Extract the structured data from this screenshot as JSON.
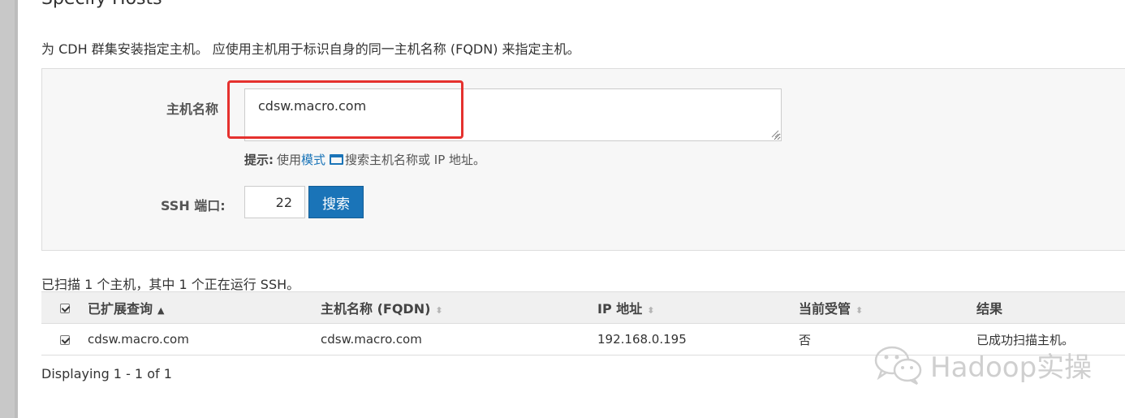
{
  "page": {
    "heading": "Specify Hosts",
    "intro": "为 CDH 群集安装指定主机。 应使用主机用于标识自身的同一主机名称 (FQDN) 来指定主机。"
  },
  "search": {
    "host_label": "主机名称",
    "host_value": "cdsw.macro.com",
    "hint_bold": "提示:",
    "hint_prefix": "使用",
    "hint_link": "模式",
    "hint_suffix": "搜索主机名称或 IP 地址。",
    "ssh_label": "SSH 端口:",
    "ssh_port": "22",
    "search_button": "搜索"
  },
  "results": {
    "summary": "已扫描 1 个主机，其中 1 个正在运行 SSH。",
    "columns": [
      {
        "label": "已扩展查询",
        "sort": "▲"
      },
      {
        "label": "主机名称 (FQDN)",
        "sort": "⬍"
      },
      {
        "label": "IP 地址",
        "sort": "⬍"
      },
      {
        "label": "当前受管",
        "sort": "⬍"
      },
      {
        "label": "结果",
        "sort": ""
      }
    ],
    "rows": [
      {
        "query": "cdsw.macro.com",
        "hostname": "cdsw.macro.com",
        "ip": "192.168.0.195",
        "managed": "否",
        "result": "已成功扫描主机。"
      }
    ],
    "paging": "Displaying 1 - 1 of 1"
  },
  "watermark": {
    "text": "Hadoop实操",
    "icon": "wechat-icon",
    "color": "#cfcfcf"
  },
  "colors": {
    "accent": "#1a74b8",
    "highlight": "#e5312e"
  }
}
